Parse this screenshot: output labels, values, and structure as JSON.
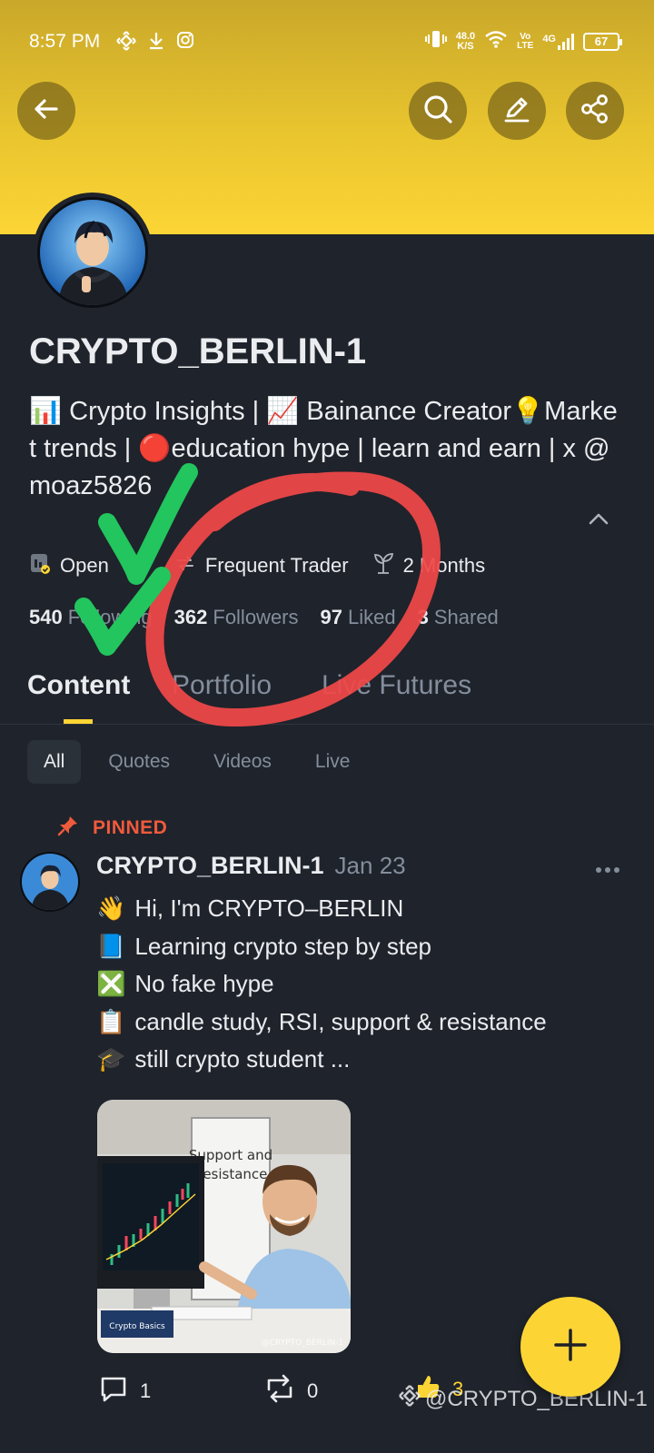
{
  "status_bar": {
    "time": "8:57 PM",
    "net_speed_value": "48.0",
    "net_speed_unit": "K/S",
    "volte_top": "Vo",
    "volte_bottom": "LTE",
    "network": "4G",
    "battery": "67"
  },
  "profile": {
    "username": "CRYPTO_BERLIN-1",
    "bio": "📊 Crypto Insights | 📈 Bainance Creator💡Market trends | 🔴education hype | learn and earn | x @moaz5826",
    "badges": [
      {
        "icon": "open-account-icon",
        "label": "Open"
      },
      {
        "icon": "frequent-trader-icon",
        "label": "Frequent Trader"
      },
      {
        "icon": "sprout-icon",
        "label": "2 Months"
      }
    ],
    "stats": {
      "following": {
        "value": "540",
        "label": "Following"
      },
      "followers": {
        "value": "362",
        "label": "Followers"
      },
      "liked": {
        "value": "97",
        "label": "Liked"
      },
      "shared": {
        "value": "3",
        "label": "Shared"
      }
    }
  },
  "tabs": [
    {
      "label": "Content",
      "active": true
    },
    {
      "label": "Portfolio",
      "active": false
    },
    {
      "label": "Live Futures",
      "active": false
    }
  ],
  "filters": [
    {
      "label": "All",
      "active": true
    },
    {
      "label": "Quotes",
      "active": false
    },
    {
      "label": "Videos",
      "active": false
    },
    {
      "label": "Live",
      "active": false
    }
  ],
  "post": {
    "pinned_label": "PINNED",
    "author": "CRYPTO_BERLIN-1",
    "date": "Jan 23",
    "lines": [
      {
        "emoji": "👋",
        "text": "Hi, I'm CRYPTO–BERLIN"
      },
      {
        "emoji": "📘",
        "text": "Learning crypto step by step"
      },
      {
        "emoji": "❎",
        "text": "No fake hype"
      },
      {
        "emoji": "📋",
        "text": "candle study, RSI, support & resistance"
      },
      {
        "emoji": "🎓",
        "text": "still crypto student ..."
      }
    ],
    "image_text": {
      "board_line1": "Support and",
      "board_line2": "Resistance",
      "book": "Crypto Basics",
      "credit": "@CRYPTO_BERLIN-1"
    },
    "comments": "1",
    "reposts": "0",
    "likes": "3"
  },
  "watermark": "@CRYPTO_BERLIN-1",
  "colors": {
    "brand_yellow": "#fcd535",
    "background": "#1f232b",
    "muted_text": "#848e9c",
    "pinned": "#f05a3c",
    "annotation_red": "#f04848",
    "annotation_green": "#22c55e"
  }
}
